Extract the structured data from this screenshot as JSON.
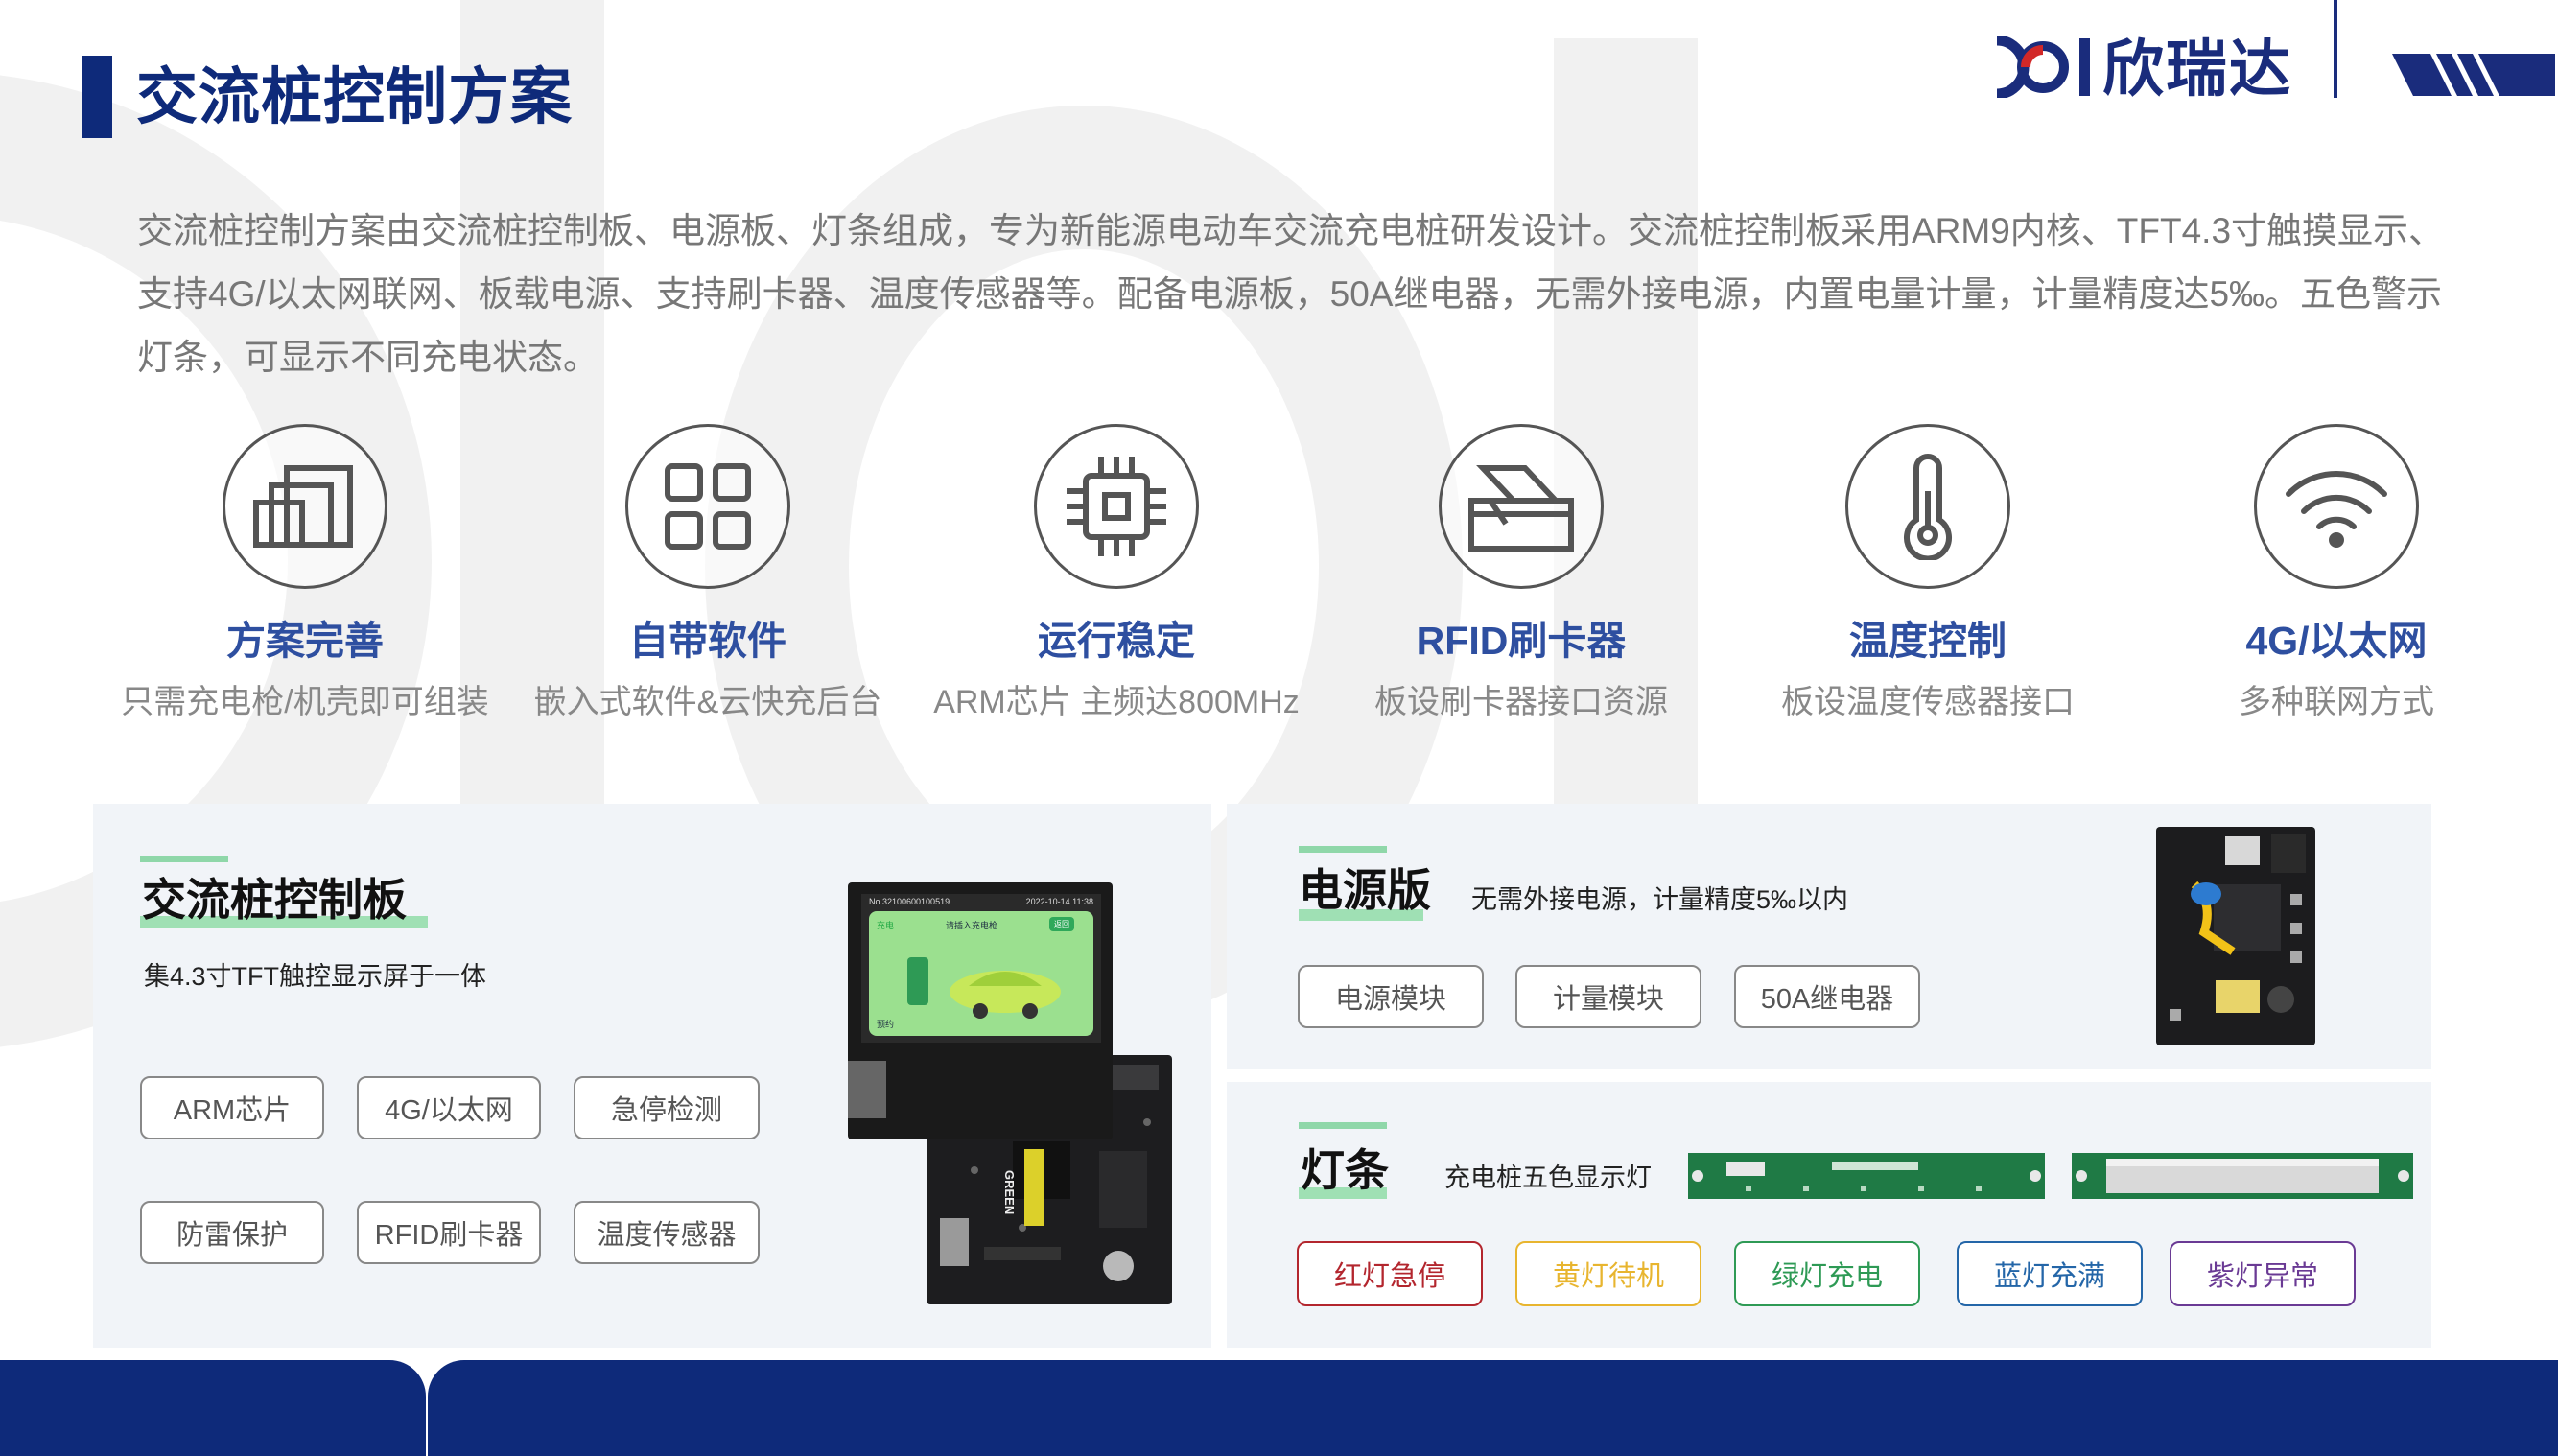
{
  "page": {
    "title": "交流桩控制方案",
    "intro": "交流桩控制方案由交流桩控制板、电源板、灯条组成，专为新能源电动车交流充电桩研发设计。交流桩控制板采用ARM9内核、TFT4.3寸触摸显示、支持4G/以太网联网、板载电源、支持刷卡器、温度传感器等。配备电源板，50A继电器，无需外接电源，内置电量计量，计量精度达5‰。五色警示灯条，可显示不同充电状态。"
  },
  "logo": {
    "text": "欣瑞达"
  },
  "features": [
    {
      "icon": "panels-icon",
      "title": "方案完善",
      "desc": "只需充电枪/机壳即可组装"
    },
    {
      "icon": "grid-icon",
      "title": "自带软件",
      "desc": "嵌入式软件&云快充后台"
    },
    {
      "icon": "chip-icon",
      "title": "运行稳定",
      "desc": "ARM芯片 主频达800MHz"
    },
    {
      "icon": "card-reader-icon",
      "title": "RFID刷卡器",
      "desc": "板设刷卡器接口资源"
    },
    {
      "icon": "thermometer-icon",
      "title": "温度控制",
      "desc": "板设温度传感器接口"
    },
    {
      "icon": "wifi-icon",
      "title": "4G/以太网",
      "desc": "多种联网方式"
    }
  ],
  "control_board": {
    "title": "交流桩控制板",
    "subtitle": "集4.3寸TFT触控显示屏于一体",
    "tags": [
      "ARM芯片",
      "4G/以太网",
      "急停检测",
      "防雷保护",
      "RFID刷卡器",
      "温度传感器"
    ],
    "screen": {
      "top_left": "No.32100600100519",
      "top_right": "2022-10-14 11:38",
      "left_label": "充电",
      "center_label": "请插入充电枪",
      "button": "返回",
      "bottom_label": "预约"
    },
    "pcb_label": "GREEN"
  },
  "power_board": {
    "title": "电源版",
    "subtitle": "无需外接电源，计量精度5‰以内",
    "tags": [
      "电源模块",
      "计量模块",
      "50A继电器"
    ]
  },
  "light_bar": {
    "title": "灯条",
    "subtitle": "充电桩五色显示灯",
    "tags": [
      {
        "label": "红灯急停",
        "color": "#b3262e"
      },
      {
        "label": "黄灯待机",
        "color": "#e8b52f"
      },
      {
        "label": "绿灯充电",
        "color": "#2e9a55"
      },
      {
        "label": "蓝灯充满",
        "color": "#2466a8"
      },
      {
        "label": "紫灯异常",
        "color": "#6a3a94"
      }
    ]
  },
  "colors": {
    "brand_navy": "#0e2a7a",
    "feature_title_blue": "#2e4fa0",
    "accent_green": "#8fd7a9",
    "panel_bg": "#f1f4f8"
  }
}
